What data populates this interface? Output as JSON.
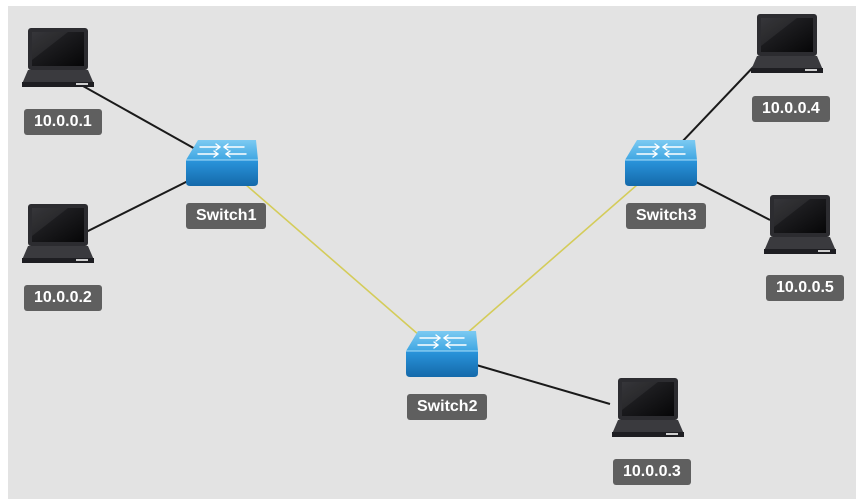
{
  "topology": {
    "switches": [
      {
        "id": "s1",
        "label": "Switch1"
      },
      {
        "id": "s2",
        "label": "Switch2"
      },
      {
        "id": "s3",
        "label": "Switch3"
      }
    ],
    "hosts": [
      {
        "id": "h1",
        "label": "10.0.0.1"
      },
      {
        "id": "h2",
        "label": "10.0.0.2"
      },
      {
        "id": "h3",
        "label": "10.0.0.3"
      },
      {
        "id": "h4",
        "label": "10.0.0.4"
      },
      {
        "id": "h5",
        "label": "10.0.0.5"
      }
    ],
    "links": [
      {
        "from": "h1",
        "to": "s1",
        "kind": "host"
      },
      {
        "from": "h2",
        "to": "s1",
        "kind": "host"
      },
      {
        "from": "s1",
        "to": "s2",
        "kind": "trunk"
      },
      {
        "from": "s2",
        "to": "s3",
        "kind": "trunk"
      },
      {
        "from": "s2",
        "to": "h3",
        "kind": "host"
      },
      {
        "from": "s3",
        "to": "h4",
        "kind": "host"
      },
      {
        "from": "s3",
        "to": "h5",
        "kind": "host"
      }
    ]
  },
  "colors": {
    "background": "#e3e3e3",
    "label_bg": "#5f5f5f",
    "label_text": "#ffffff",
    "host_link": "#1a1a1a",
    "trunk_link": "#d4cc5a",
    "switch_blue": "#1f86cc",
    "switch_top": "#52b5ea",
    "laptop_body": "#2c2c30",
    "laptop_screen": "#0c0c0e"
  },
  "icons": {
    "switch": "network-switch-icon",
    "host": "laptop-icon"
  }
}
